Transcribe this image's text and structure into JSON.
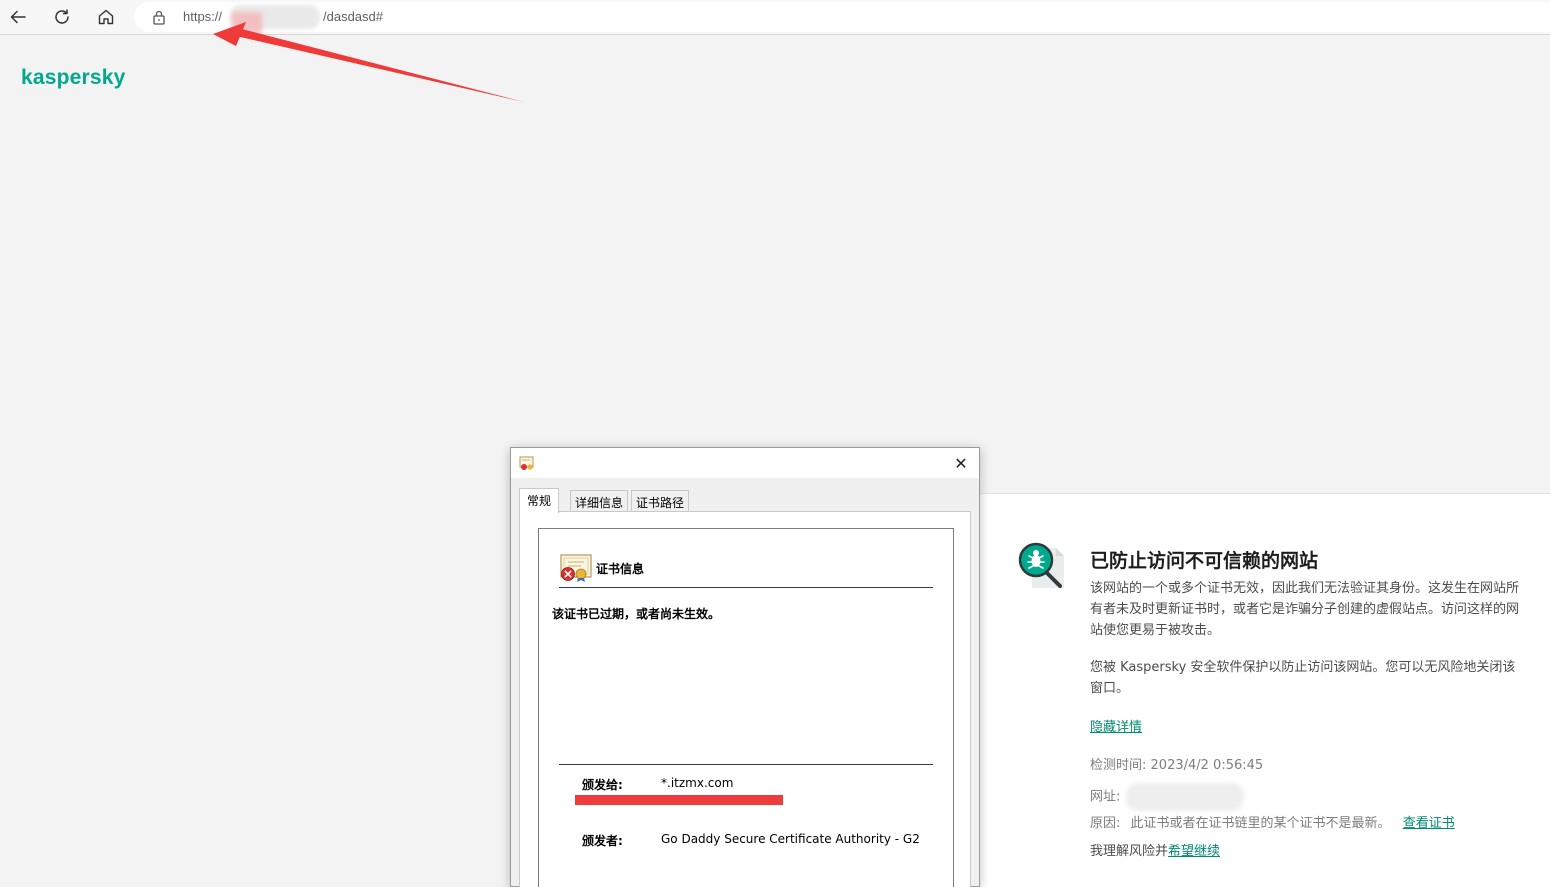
{
  "browser": {
    "url_scheme": "https://",
    "url_path": "/dasdasd#"
  },
  "logo": "kaspersky",
  "warning": {
    "title": "已防止访问不可信赖的网站",
    "paragraph1": "该网站的一个或多个证书无效，因此我们无法验证其身份。这发生在网站所有者未及时更新证书时，或者它是诈骗分子创建的虚假站点。访问这样的网站使您更易于被攻击。",
    "paragraph2": "您被 Kaspersky 安全软件保护以防止访问该网站。您可以无风险地关闭该窗口。",
    "hide_details": "隐藏详情",
    "detected_label": "检测时间:",
    "detected_value": "2023/4/2 0:56:45",
    "address_label": "网址:",
    "reason_label": "原因:",
    "reason_value": "此证书或者在证书链里的某个证书不是最新。",
    "view_cert": "查看证书",
    "understand_prefix": "我理解风险并",
    "continue_link": "希望继续"
  },
  "dialog": {
    "tabs": [
      "常规",
      "详细信息",
      "证书路径"
    ],
    "cert_info_title": "证书信息",
    "status": "该证书已过期，或者尚未生效。",
    "issued_to_label": "颁发给:",
    "issued_to_value": "*.itzmx.com",
    "issued_by_label": "颁发者:",
    "issued_by_value": "Go Daddy Secure Certificate Authority - G2"
  },
  "colors": {
    "brand": "#00a88e",
    "link": "#008b72",
    "annotation_arrow": "#f03a3a",
    "redaction_bar": "#ee3b3b"
  }
}
